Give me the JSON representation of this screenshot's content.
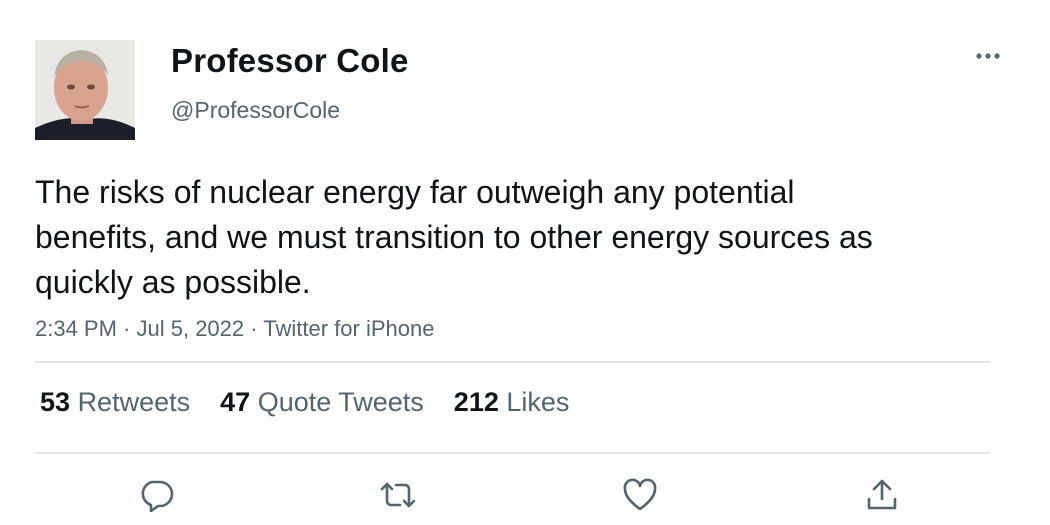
{
  "tweet": {
    "author_name": "Professor Cole",
    "author_handle": "@ProfessorCole",
    "text": "The risks of nuclear energy far outweigh any potential benefits, and we must transition to other energy sources as quickly as possible.",
    "time": "2:34 PM",
    "date": "Jul 5, 2022",
    "source": "Twitter for iPhone",
    "separator": " · "
  },
  "stats": [
    {
      "count": "53",
      "label": "Retweets"
    },
    {
      "count": "47",
      "label": "Quote Tweets"
    },
    {
      "count": "212",
      "label": "Likes"
    }
  ],
  "icons": {
    "more": "more-horizontal-icon",
    "reply": "reply-icon",
    "retweet": "retweet-icon",
    "like": "heart-icon",
    "share": "share-icon"
  },
  "colors": {
    "text": "#0f1419",
    "secondary": "#536471",
    "divider": "#e3e6e9",
    "icon": "#536471"
  }
}
